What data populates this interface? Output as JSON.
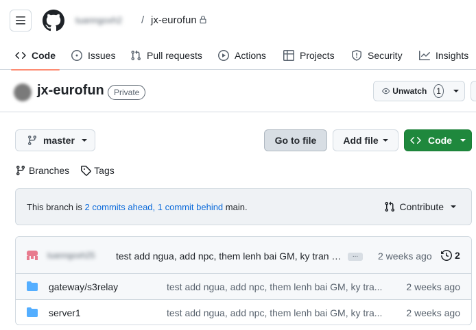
{
  "header": {
    "owner": "tuanngoxh2",
    "separator": "/",
    "repo": "jx-eurofun"
  },
  "tabs": [
    {
      "label": "Code",
      "icon": "code-icon",
      "active": true
    },
    {
      "label": "Issues",
      "icon": "issue-icon"
    },
    {
      "label": "Pull requests",
      "icon": "pull-request-icon"
    },
    {
      "label": "Actions",
      "icon": "play-icon"
    },
    {
      "label": "Projects",
      "icon": "table-icon"
    },
    {
      "label": "Security",
      "icon": "shield-icon"
    },
    {
      "label": "Insights",
      "icon": "graph-icon"
    }
  ],
  "repo_header": {
    "name": "jx-eurofun",
    "visibility": "Private",
    "watch_label": "Unwatch",
    "watch_count": "1"
  },
  "branch_bar": {
    "branch": "master",
    "go_to_file": "Go to file",
    "add_file": "Add file",
    "code": "Code",
    "branches": "Branches",
    "tags": "Tags"
  },
  "ahead_behind": {
    "prefix": "This branch is ",
    "ahead_link": "2 commits ahead,",
    "behind_link": "1 commit behind",
    "suffix": " main.",
    "contribute": "Contribute"
  },
  "latest_commit": {
    "author": "tuanngoxh25",
    "message": "test add ngua, add npc, them lenh bai GM, ky tran c...",
    "more": "...",
    "time": "2 weeks ago",
    "commit_count": "2"
  },
  "files": [
    {
      "name": "gateway/s3relay",
      "message": "test add ngua, add npc, them lenh bai GM, ky tra...",
      "time": "2 weeks ago"
    },
    {
      "name": "server1",
      "message": "test add ngua, add npc, them lenh bai GM, ky tra...",
      "time": "2 weeks ago"
    }
  ],
  "colors": {
    "accent_underline": "#fd8c73",
    "code_button": "#1f883d",
    "link": "#0969da",
    "folder": "#54aeff"
  }
}
